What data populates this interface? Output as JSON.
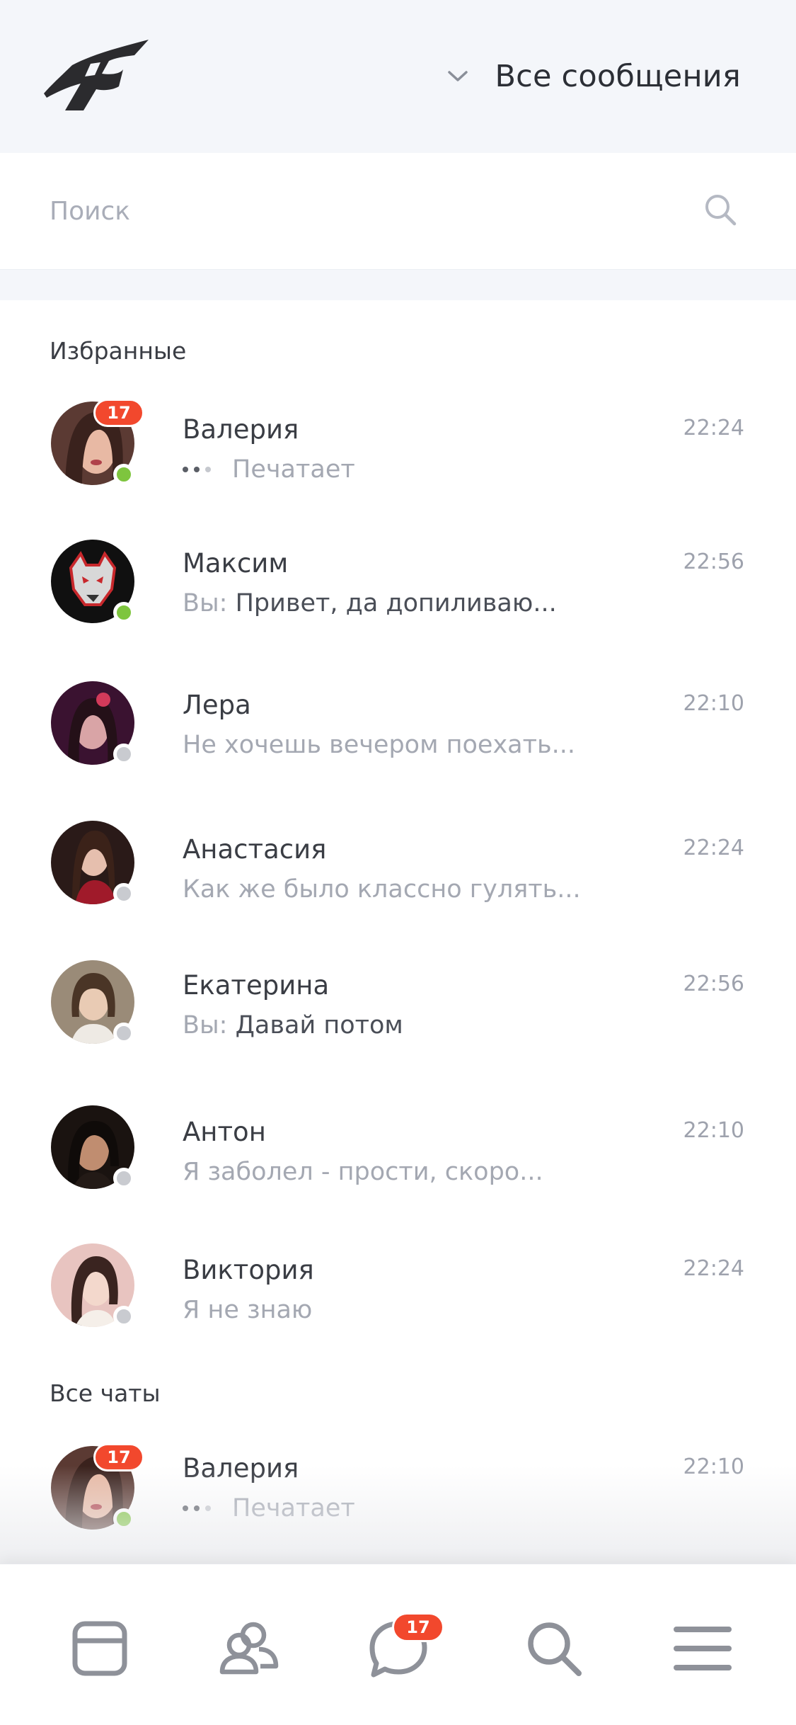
{
  "header": {
    "filter_label": "Все сообщения"
  },
  "search": {
    "placeholder": "Поиск"
  },
  "sections": {
    "favorites_title": "Избранные",
    "all_chats_title": "Все чаты"
  },
  "favorites": [
    {
      "name": "Валерия",
      "time": "22:24",
      "typing": true,
      "preview": "Печатает",
      "online": true,
      "badge": "17"
    },
    {
      "name": "Максим",
      "time": "22:56",
      "you_prefix": "Вы:",
      "preview": "Привет, да допиливаю...",
      "online": true
    },
    {
      "name": "Лера",
      "time": "22:10",
      "preview": "Не хочешь вечером поехать...",
      "online": false
    },
    {
      "name": "Анастасия",
      "time": "22:24",
      "preview": "Как же было классно гулять...",
      "online": false
    },
    {
      "name": "Екатерина",
      "time": "22:56",
      "you_prefix": "Вы:",
      "preview": "Давай потом",
      "online": false
    },
    {
      "name": "Антон",
      "time": "22:10",
      "preview": "Я заболел - прости, скоро...",
      "online": false
    },
    {
      "name": "Виктория",
      "time": "22:24",
      "preview": "Я не знаю",
      "online": false
    }
  ],
  "all_chats": [
    {
      "name": "Валерия",
      "time": "22:10",
      "typing": true,
      "preview": "Печатает",
      "online": true,
      "badge": "17"
    }
  ],
  "tabbar": {
    "items": [
      {
        "icon": "feed-icon"
      },
      {
        "icon": "friends-icon"
      },
      {
        "icon": "messages-icon",
        "badge": "17"
      },
      {
        "icon": "search-icon"
      },
      {
        "icon": "menu-icon"
      }
    ]
  },
  "colors": {
    "accent": "#f2482d",
    "online": "#7ec53e",
    "header_bg": "#f4f6fa"
  }
}
